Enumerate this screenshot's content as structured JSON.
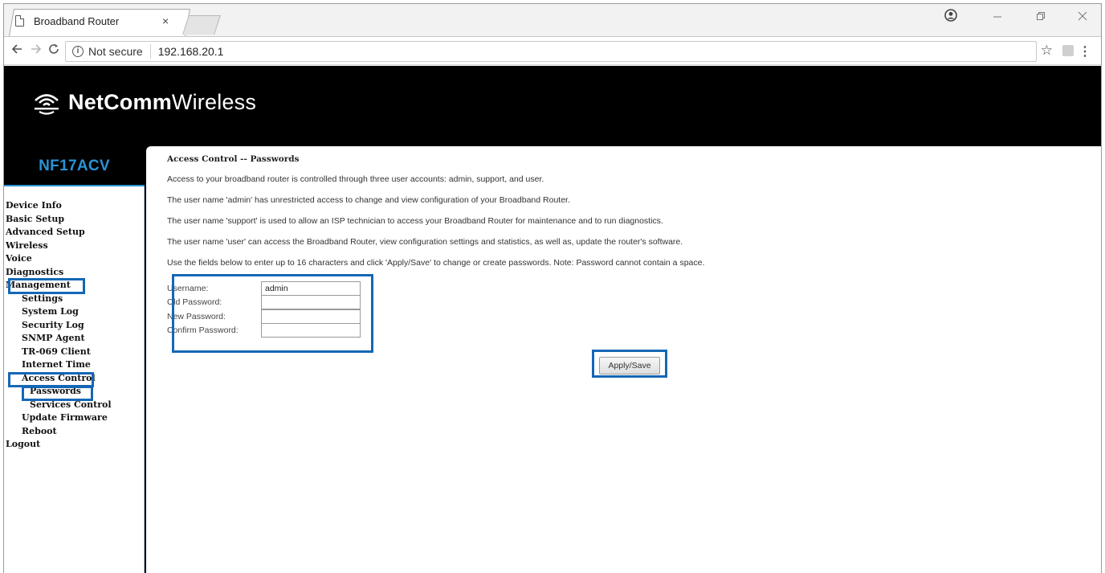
{
  "browser": {
    "tab_title": "Broadband Router",
    "tab_close": "×",
    "not_secure": "Not secure",
    "url": "192.168.20.1"
  },
  "brand": {
    "name_bold": "NetComm",
    "name_light": "Wireless",
    "model": "NF17ACV"
  },
  "sidebar": {
    "items": [
      {
        "label": "Device Info"
      },
      {
        "label": "Basic Setup"
      },
      {
        "label": "Advanced Setup"
      },
      {
        "label": "Wireless"
      },
      {
        "label": "Voice"
      },
      {
        "label": "Diagnostics"
      },
      {
        "label": "Management"
      },
      {
        "label": "Settings"
      },
      {
        "label": "System Log"
      },
      {
        "label": "Security Log"
      },
      {
        "label": "SNMP Agent"
      },
      {
        "label": "TR-069 Client"
      },
      {
        "label": "Internet Time"
      },
      {
        "label": "Access Control"
      },
      {
        "label": "Passwords"
      },
      {
        "label": "Services Control"
      },
      {
        "label": "Update Firmware"
      },
      {
        "label": "Reboot"
      },
      {
        "label": "Logout"
      }
    ]
  },
  "content": {
    "title": "Access Control -- Passwords",
    "paragraphs": [
      "Access to your broadband router is controlled through three user accounts: admin, support, and user.",
      "The user name 'admin' has unrestricted access to change and view configuration of your Broadband Router.",
      "The user name 'support' is used to allow an ISP technician to access your Broadband Router for maintenance and to run diagnostics.",
      "The user name 'user' can access the Broadband Router, view configuration settings and statistics, as well as, update the router's software.",
      "Use the fields below to enter up to 16 characters and click 'Apply/Save' to change or create passwords. Note: Password cannot contain a space."
    ]
  },
  "form": {
    "username_label": "Username:",
    "username_value": "admin",
    "old_password_label": "Old Password:",
    "new_password_label": "New Password:",
    "confirm_password_label": "Confirm Password:",
    "apply_label": "Apply/Save"
  },
  "colors": {
    "accent_blue": "#2a93d5",
    "highlight_blue": "#1567b6",
    "header_bg": "#000000"
  }
}
